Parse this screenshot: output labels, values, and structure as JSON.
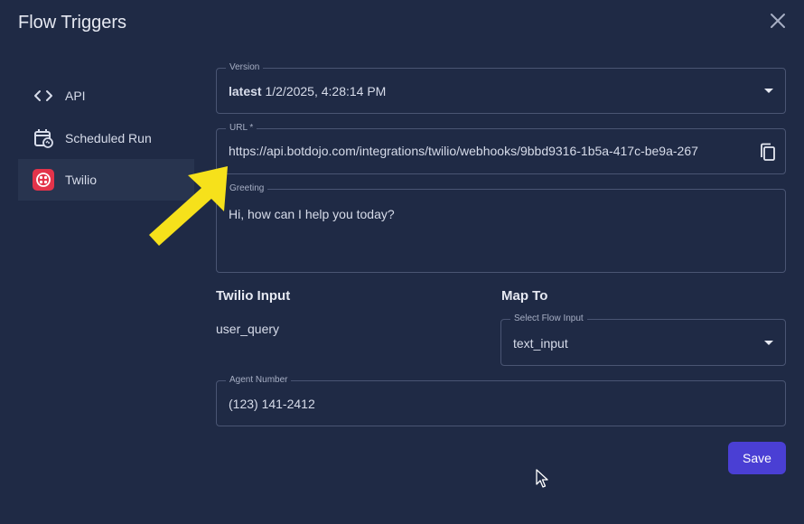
{
  "dialog": {
    "title": "Flow Triggers"
  },
  "nav": [
    {
      "label": "API",
      "icon": "code-icon"
    },
    {
      "label": "Scheduled Run",
      "icon": "calendar-refresh-icon"
    },
    {
      "label": "Twilio",
      "icon": "twilio-icon"
    }
  ],
  "form": {
    "version": {
      "label": "Version",
      "tag": "latest",
      "value": "1/2/2025, 4:28:14 PM"
    },
    "url": {
      "label": "URL *",
      "value": "https://api.botdojo.com/integrations/twilio/webhooks/9bbd9316-1b5a-417c-be9a-267"
    },
    "greeting": {
      "label": "Greeting",
      "value": "Hi, how can I help you today?"
    },
    "mapping": {
      "input_header": "Twilio Input",
      "map_header": "Map To",
      "input_value": "user_query",
      "select_label": "Select Flow Input",
      "select_value": "text_input"
    },
    "agent_number": {
      "label": "Agent Number",
      "value": "(123) 141-2412"
    },
    "save_label": "Save"
  },
  "colors": {
    "background": "#1f2a45",
    "accent": "#4a3fd4",
    "arrow": "#f6e11b",
    "twilio": "#e3334a"
  }
}
